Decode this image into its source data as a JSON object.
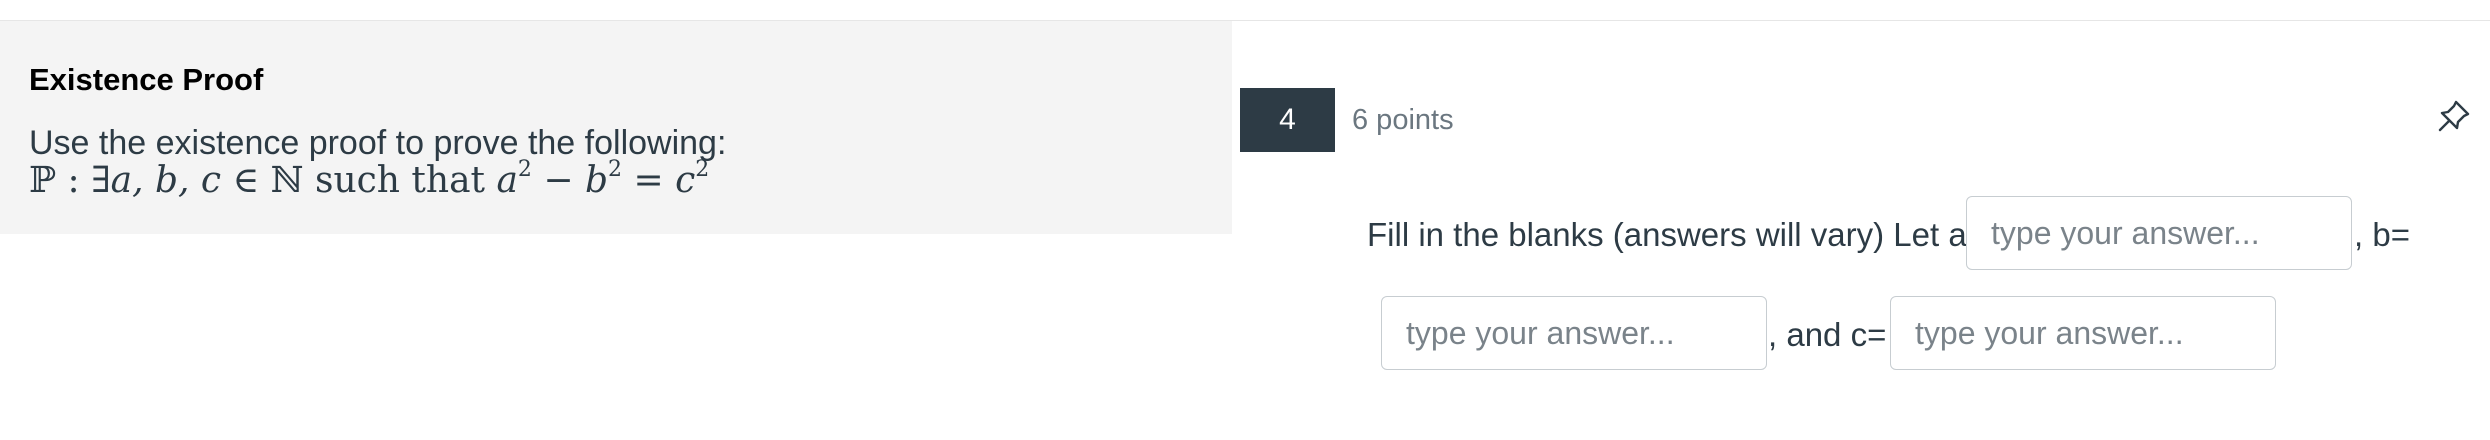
{
  "stimulus": {
    "title": "Existence Proof",
    "instruction": "Use the existence proof to prove the following:",
    "statement": {
      "prefix": "ℙ : ∃",
      "vars": "a, b, c",
      "member": " ∈ ℕ such that ",
      "a": "a",
      "b": "b",
      "c": "c",
      "exp": "2",
      "minus": " − ",
      "equals": " = "
    }
  },
  "question": {
    "number": "4",
    "points": "6 points",
    "pin_icon": "pin-icon",
    "prompt": "Fill in the blanks (answers will vary) Let a =",
    "after_a": ", b=",
    "after_b": ", and c=",
    "answers": [
      {
        "value": "",
        "placeholder": "type your answer..."
      },
      {
        "value": "",
        "placeholder": "type your answer..."
      },
      {
        "value": "",
        "placeholder": "type your answer..."
      }
    ]
  },
  "colors": {
    "stimulus_bg": "#f4f4f4",
    "question_number_bg": "#2d3b45",
    "text": "#2d3b45",
    "muted_text": "#6b7780"
  }
}
